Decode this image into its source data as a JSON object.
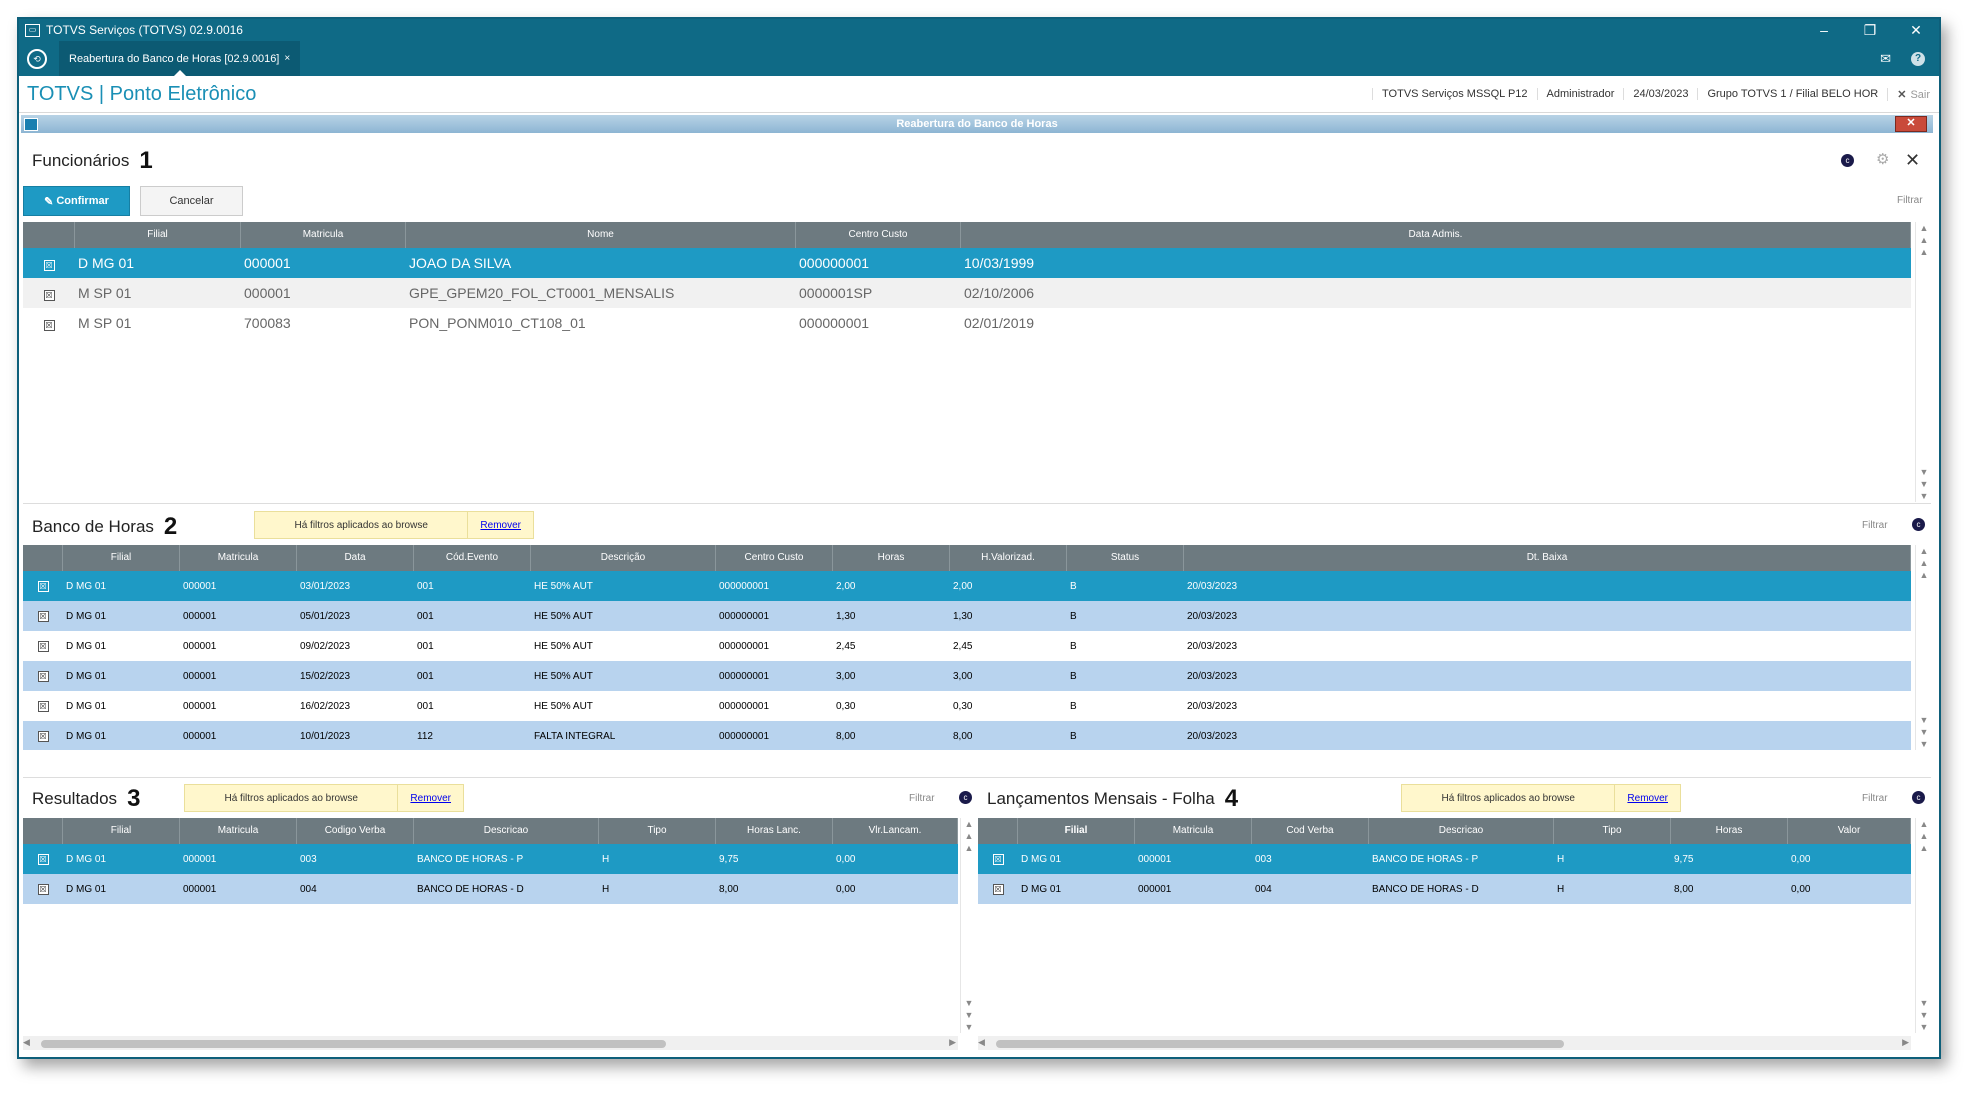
{
  "window": {
    "title": "TOTVS Serviços (TOTVS) 02.9.0016",
    "minimize": "–",
    "restore": "❐",
    "close": "✕"
  },
  "tabbar": {
    "tab_label": "Reabertura do Banco de Horas [02.9.0016]",
    "tab_close": "×"
  },
  "app": {
    "title": "TOTVS | Ponto Eletrônico",
    "info": [
      "TOTVS Serviços MSSQL P12",
      "Administrador",
      "24/03/2023",
      "Grupo TOTVS 1 / Filial BELO HOR"
    ],
    "exit_label": "Sair"
  },
  "dialog": {
    "title": "Reabertura do Banco de Horas"
  },
  "funcionarios": {
    "title": "Funcionários",
    "number": "1",
    "confirm_label": "Confirmar",
    "cancel_label": "Cancelar",
    "filter_label": "Filtrar",
    "columns": [
      "Filial",
      "Matricula",
      "Nome",
      "Centro Custo",
      "Data Admis."
    ],
    "rows": [
      {
        "filial": "D MG 01",
        "matricula": "000001",
        "nome": "JOAO DA SILVA",
        "centro_custo": "000000001",
        "data_admis": "10/03/1999"
      },
      {
        "filial": "M SP 01",
        "matricula": "000001",
        "nome": "GPE_GPEM20_FOL_CT0001_MENSALIS",
        "centro_custo": "0000001SP",
        "data_admis": "02/10/2006"
      },
      {
        "filial": "M SP 01",
        "matricula": "700083",
        "nome": "PON_PONM010_CT108_01",
        "centro_custo": "000000001",
        "data_admis": "02/01/2019"
      }
    ]
  },
  "banco_horas": {
    "title": "Banco de Horas",
    "number": "2",
    "notice": "Há filtros aplicados ao browse",
    "remove_label": "Remover",
    "filter_label": "Filtrar",
    "columns": [
      "Filial",
      "Matricula",
      "Data",
      "Cód.Evento",
      "Descrição",
      "Centro Custo",
      "Horas",
      "H.Valorizad.",
      "Status",
      "Dt. Baixa"
    ],
    "rows": [
      [
        "D MG 01",
        "000001",
        "03/01/2023",
        "001",
        "HE 50% AUT",
        "000000001",
        "2,00",
        "2,00",
        "B",
        "20/03/2023"
      ],
      [
        "D MG 01",
        "000001",
        "05/01/2023",
        "001",
        "HE 50% AUT",
        "000000001",
        "1,30",
        "1,30",
        "B",
        "20/03/2023"
      ],
      [
        "D MG 01",
        "000001",
        "09/02/2023",
        "001",
        "HE 50% AUT",
        "000000001",
        "2,45",
        "2,45",
        "B",
        "20/03/2023"
      ],
      [
        "D MG 01",
        "000001",
        "15/02/2023",
        "001",
        "HE 50% AUT",
        "000000001",
        "3,00",
        "3,00",
        "B",
        "20/03/2023"
      ],
      [
        "D MG 01",
        "000001",
        "16/02/2023",
        "001",
        "HE 50% AUT",
        "000000001",
        "0,30",
        "0,30",
        "B",
        "20/03/2023"
      ],
      [
        "D MG 01",
        "000001",
        "10/01/2023",
        "112",
        "FALTA INTEGRAL",
        "000000001",
        "8,00",
        "8,00",
        "B",
        "20/03/2023"
      ]
    ]
  },
  "resultados": {
    "title": "Resultados",
    "number": "3",
    "notice": "Há filtros aplicados ao browse",
    "remove_label": "Remover",
    "filter_label": "Filtrar",
    "columns": [
      "Filial",
      "Matricula",
      "Codigo Verba",
      "Descricao",
      "Tipo",
      "Horas Lanc.",
      "Vlr.Lancam."
    ],
    "rows": [
      [
        "D MG 01",
        "000001",
        "003",
        "BANCO DE HORAS - P",
        "H",
        "9,75",
        "0,00"
      ],
      [
        "D MG 01",
        "000001",
        "004",
        "BANCO DE HORAS - D",
        "H",
        "8,00",
        "0,00"
      ]
    ]
  },
  "lancamentos": {
    "title": "Lançamentos Mensais - Folha",
    "number": "4",
    "notice": "Há filtros aplicados ao browse",
    "remove_label": "Remover",
    "filter_label": "Filtrar",
    "columns": [
      "Filial",
      "Matricula",
      "Cod Verba",
      "Descricao",
      "Tipo",
      "Horas",
      "Valor"
    ],
    "rows": [
      [
        "D MG 01",
        "000001",
        "003",
        "BANCO DE HORAS - P",
        "H",
        "9,75",
        "0,00"
      ],
      [
        "D MG 01",
        "000001",
        "004",
        "BANCO DE HORAS - D",
        "H",
        "8,00",
        "0,00"
      ]
    ]
  },
  "icons": {
    "check": "☒",
    "pencil": "✎",
    "gear": "⚙",
    "close": "✕",
    "mail": "✉",
    "help": "?"
  }
}
